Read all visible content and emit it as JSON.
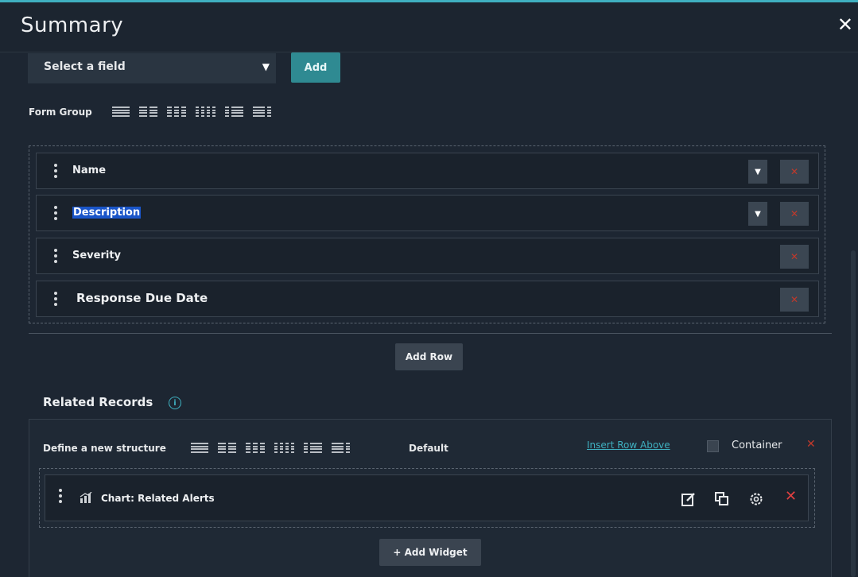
{
  "header": {
    "title": "Summary",
    "close_icon": "close-icon"
  },
  "field_picker": {
    "selected": "Select a field",
    "add_label": "Add"
  },
  "form_group": {
    "label": "Form Group",
    "layout_icons": [
      "1-col",
      "2-col",
      "3-col",
      "4-col",
      "1-2-col",
      "2-1-col"
    ]
  },
  "form_rows": [
    {
      "label": "Name",
      "has_dropdown": true
    },
    {
      "label": "Description",
      "has_dropdown": true,
      "selected_text": true
    },
    {
      "label": "Severity",
      "has_dropdown": false
    },
    {
      "label": "Response Due Date",
      "has_dropdown": false
    }
  ],
  "add_row_label": "Add Row",
  "related_records": {
    "title": "Related Records",
    "info_icon": "info-icon",
    "define_label": "Define a new structure",
    "default_label": "Default",
    "insert_row_above": "Insert Row Above",
    "container_label": "Container",
    "container_checked": false,
    "widgets": [
      {
        "label": "Chart: Related Alerts",
        "icon": "chart-icon"
      }
    ],
    "add_widget_label": "+ Add Widget"
  },
  "colors": {
    "accent": "#3fb0c0",
    "danger": "#c0392b",
    "selection": "#1a55c9"
  }
}
